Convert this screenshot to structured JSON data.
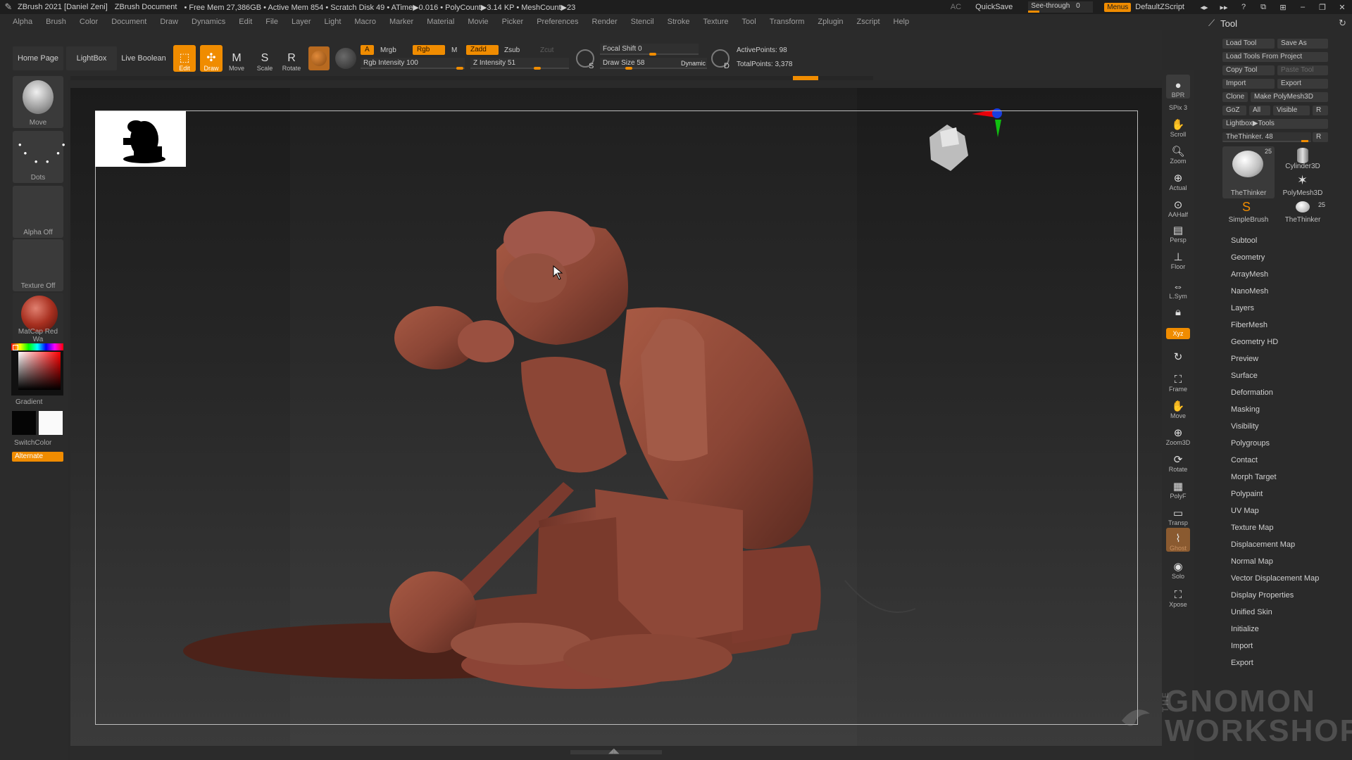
{
  "titlebar": {
    "app": "ZBrush 2021 [Daniel Zeni]",
    "document": "ZBrush Document",
    "stats": "• Free Mem 27,386GB • Active Mem 854 • Scratch Disk 49 • ATime▶0.016 • PolyCount▶3.14 KP • MeshCount▶23",
    "ac": "AC",
    "quicksave": "QuickSave",
    "seethrough_label": "See-through",
    "seethrough_value": "0",
    "menus": "Menus",
    "script": "DefaultZScript"
  },
  "menubar": [
    "Alpha",
    "Brush",
    "Color",
    "Document",
    "Draw",
    "Dynamics",
    "Edit",
    "File",
    "Layer",
    "Light",
    "Macro",
    "Marker",
    "Material",
    "Movie",
    "Picker",
    "Preferences",
    "Render",
    "Stencil",
    "Stroke",
    "Texture",
    "Tool",
    "Transform",
    "Zplugin",
    "Zscript",
    "Help"
  ],
  "shelf": {
    "home": "Home Page",
    "lightbox": "LightBox",
    "live_boolean": "Live Boolean",
    "edit": "Edit",
    "draw": "Draw",
    "move": "Move",
    "scale": "Scale",
    "rotate": "Rotate",
    "a": "A",
    "mrgb": "Mrgb",
    "rgb": "Rgb",
    "m": "M",
    "zadd": "Zadd",
    "zsub": "Zsub",
    "zcut": "Zcut",
    "rgb_intensity": "Rgb Intensity 100",
    "z_intensity": "Z Intensity 51",
    "focal_shift": "Focal Shift 0",
    "draw_size": "Draw Size 58",
    "dynamic": "Dynamic",
    "s": "S",
    "d": "D",
    "active_points": "ActivePoints: 98",
    "total_points": "TotalPoints: 3,378"
  },
  "left": {
    "brush": "Move",
    "stroke": "Dots",
    "alpha": "Alpha Off",
    "texture": "Texture Off",
    "material": "MatCap Red Wa",
    "gradient": "Gradient",
    "switch": "SwitchColor",
    "alternate": "Alternate"
  },
  "rightstrip": {
    "bpr": "BPR",
    "spix": "SPix 3",
    "scroll": "Scroll",
    "zoom": "Zoom",
    "actual": "Actual",
    "aahalf": "AAHalf",
    "persp": "Persp",
    "floor": "Floor",
    "lsym": "L.Sym",
    "xyz": "Xyz",
    "frame": "Frame",
    "move": "Move",
    "zoom3d": "Zoom3D",
    "rotate": "Rotate",
    "polyf": "PolyF",
    "transp": "Transp",
    "ghost": "Ghost",
    "solo": "Solo",
    "xpose": "Xpose"
  },
  "tool": {
    "title": "Tool",
    "load_tool": "Load Tool",
    "save_as": "Save As",
    "load_from_project": "Load Tools From Project",
    "copy_tool": "Copy Tool",
    "paste_tool": "Paste Tool",
    "import": "Import",
    "export": "Export",
    "clone": "Clone",
    "make_polymesh": "Make PolyMesh3D",
    "goz": "GoZ",
    "all": "All",
    "visible": "Visible",
    "r": "R",
    "lightbox_tools": "Lightbox▶Tools",
    "current": "TheThinker. 48",
    "slots": [
      {
        "name": "TheThinker",
        "count": "25"
      },
      {
        "name": "Cylinder3D",
        "count": ""
      },
      {
        "name": "PolyMesh3D",
        "count": ""
      },
      {
        "name": "SimpleBrush",
        "count": ""
      },
      {
        "name": "TheThinker",
        "count": "25"
      }
    ],
    "subpalettes": [
      "Subtool",
      "Geometry",
      "ArrayMesh",
      "NanoMesh",
      "Layers",
      "FiberMesh",
      "Geometry HD",
      "Preview",
      "Surface",
      "Deformation",
      "Masking",
      "Visibility",
      "Polygroups",
      "Contact",
      "Morph Target",
      "Polypaint",
      "UV Map",
      "Texture Map",
      "Displacement Map",
      "Normal Map",
      "Vector Displacement Map",
      "Display Properties",
      "Unified Skin",
      "Initialize",
      "Import",
      "Export"
    ]
  },
  "watermark": {
    "the": "THE",
    "line1": "GNOMON",
    "line2": "WORKSHOP"
  },
  "colors": {
    "accent": "#f08c00",
    "model": "#8a4535"
  }
}
